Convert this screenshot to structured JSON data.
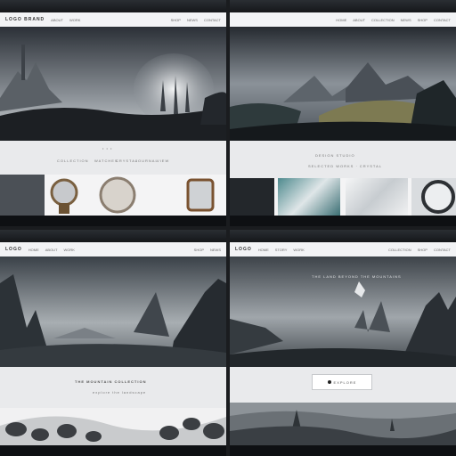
{
  "panels": [
    {
      "id": "top-left",
      "nav": {
        "logo": "LOGO BRAND",
        "items": [
          "ABOUT",
          "WORK",
          "SHOP",
          "NEWS",
          "CONTACT"
        ]
      },
      "section_dots": "• • •",
      "caption": [
        "COLLECTION",
        "WATCHES",
        "CRYSTAL",
        "JOURNAL",
        "VIEW"
      ]
    },
    {
      "id": "top-right",
      "nav": {
        "logo": "",
        "items": [
          "HOME",
          "ABOUT",
          "COLLECTION",
          "NEWS",
          "SHOP",
          "CONTACT"
        ]
      },
      "headline": "DESIGN STUDIO",
      "caption": "SELECTED WORKS · CRYSTAL"
    },
    {
      "id": "bottom-left",
      "nav": {
        "logo": "LOGO",
        "items": [
          "HOME",
          "ABOUT",
          "WORK",
          "SHOP",
          "NEWS"
        ]
      },
      "headline": "THE MOUNTAIN COLLECTION",
      "sub": "explore the landscape"
    },
    {
      "id": "bottom-right",
      "nav": {
        "logo": "LOGO",
        "items": [
          "HOME",
          "STORY",
          "WORK",
          "COLLECTION",
          "SHOP",
          "CONTACT"
        ]
      },
      "tagline": "THE LAND BEYOND THE MOUNTAINS",
      "button": "EXPLORE"
    }
  ],
  "colors": {
    "nav_bg": "#f2f3f5",
    "band_bg": "#e9eaec",
    "dark": "#0e1013"
  }
}
